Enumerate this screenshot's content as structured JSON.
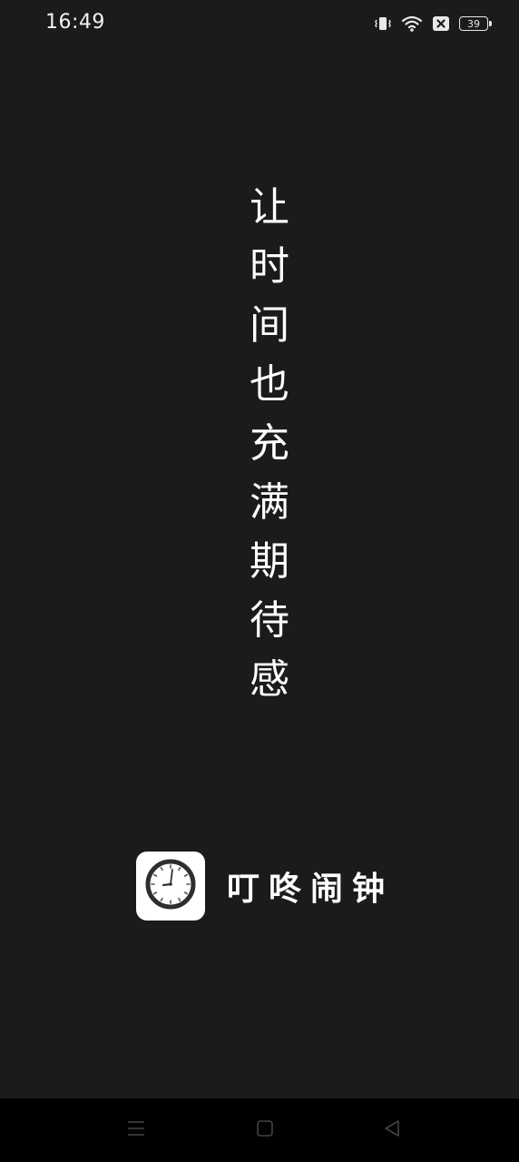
{
  "status_bar": {
    "time": "16:49",
    "icons": [
      "vibrate-icon",
      "wifi-icon",
      "no-sim-icon",
      "battery-icon"
    ],
    "battery_level": "39"
  },
  "slogan": {
    "characters": [
      "让",
      "时",
      "间",
      "也",
      "充",
      "满",
      "期",
      "待",
      "感"
    ]
  },
  "app": {
    "icon": "clock-icon",
    "name": "叮咚闹钟"
  },
  "nav_bar": {
    "buttons": [
      "menu-icon",
      "home-icon",
      "back-icon"
    ]
  },
  "colors": {
    "background": "#1b1b1b",
    "text": "#ffffff",
    "nav_background": "#000000",
    "icon_tile": "#ffffff"
  }
}
